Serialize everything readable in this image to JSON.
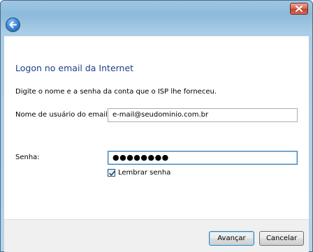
{
  "window": {
    "close_icon": "close-icon",
    "back_icon": "back-arrow-icon"
  },
  "page": {
    "heading": "Logon no email da Internet",
    "description": "Digite o nome e a senha da conta que o ISP lhe forneceu."
  },
  "form": {
    "email_label": "Nome de usuário do email:",
    "email_value": "e-mail@seudominio.com.br",
    "password_label": "Senha:",
    "password_value": "●●●●●●●●",
    "remember_label": "Lembrar senha",
    "remember_checked": true
  },
  "footer": {
    "next_label": "Avançar",
    "cancel_label": "Cancelar"
  },
  "colors": {
    "heading": "#1f3f8a",
    "frame": "#a9cce5",
    "close_button": "#c2452d"
  }
}
